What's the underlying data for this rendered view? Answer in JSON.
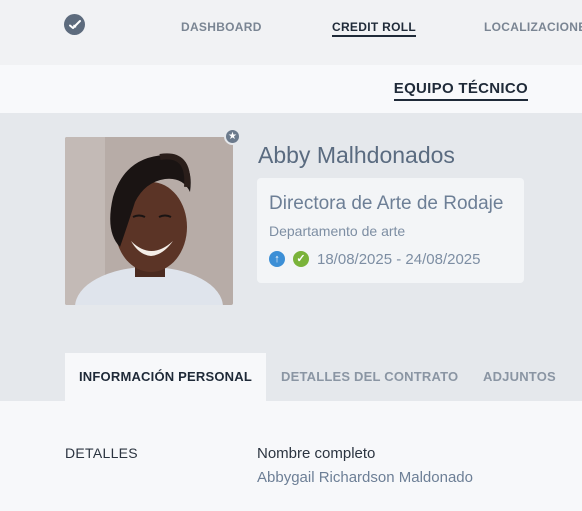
{
  "nav": {
    "items": [
      {
        "label": "DASHBOARD"
      },
      {
        "label": "CREDIT ROLL"
      },
      {
        "label": "LOCALIZACIONES"
      }
    ],
    "active_index": 1
  },
  "subnav": {
    "label": "EQUIPO TÉCNICO"
  },
  "profile": {
    "name": "Abby Malhdonados",
    "role_title": "Directora de Arte de Rodaje",
    "department": "Departamento de arte",
    "dates": "18/08/2025 - 24/08/2025",
    "star_icon": "star-icon",
    "status_icons": [
      "arrow-up-icon",
      "check-icon"
    ]
  },
  "tabs": [
    {
      "label": "INFORMACIÓN PERSONAL"
    },
    {
      "label": "DETALLES DEL CONTRATO"
    },
    {
      "label": "ADJUNTOS"
    }
  ],
  "details": {
    "section": "DETALLES",
    "full_name_label": "Nombre completo",
    "full_name_value": "Abbygail Richardson Maldonado"
  },
  "colors": {
    "accent": "#1f2a38",
    "icon_blue": "#3c8fd6",
    "icon_green": "#7ab33a"
  }
}
